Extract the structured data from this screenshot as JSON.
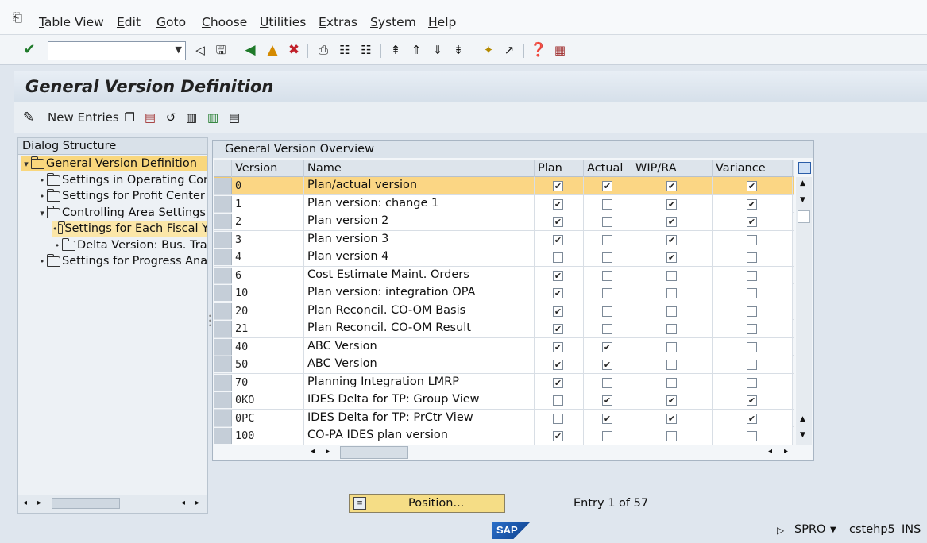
{
  "menu": {
    "items": [
      "Table View",
      "Edit",
      "Goto",
      "Choose",
      "Utilities",
      "Extras",
      "System",
      "Help"
    ]
  },
  "toolbar": {
    "command_field_value": "",
    "icons": [
      "enter-icon",
      "back-arrow-icon",
      "save-icon",
      "back-icon",
      "exit-icon",
      "cancel-icon",
      "print-icon",
      "find-icon",
      "find-next-icon",
      "first-page-icon",
      "prev-page-icon",
      "next-page-icon",
      "last-page-icon",
      "create-session-icon",
      "shortcut-icon",
      "help-icon",
      "customize-layout-icon"
    ]
  },
  "page": {
    "title": "General Version Definition"
  },
  "app_toolbar": {
    "new_entries_label": "New Entries"
  },
  "tree": {
    "header": "Dialog Structure",
    "nodes": [
      {
        "label": "General Version Definition",
        "level": 0,
        "expanded": true,
        "selected": true
      },
      {
        "label": "Settings in Operating Conc",
        "level": 1
      },
      {
        "label": "Settings for Profit Center A",
        "level": 1
      },
      {
        "label": "Controlling Area Settings",
        "level": 1,
        "expanded": true
      },
      {
        "label": "Settings for Each Fiscal Y",
        "level": 2,
        "highlight": true
      },
      {
        "label": "Delta Version: Bus. Tran",
        "level": 2
      },
      {
        "label": "Settings for Progress Analy",
        "level": 1
      }
    ]
  },
  "table": {
    "title": "General Version Overview",
    "columns": [
      "Version",
      "Name",
      "Plan",
      "Actual",
      "WIP/RA",
      "Variance"
    ],
    "rows": [
      {
        "version": "0",
        "name": "Plan/actual version",
        "plan": true,
        "actual": true,
        "wip": true,
        "variance": true,
        "selected": true
      },
      {
        "version": "1",
        "name": "Plan version: change 1",
        "plan": true,
        "actual": false,
        "wip": true,
        "variance": true
      },
      {
        "version": "2",
        "name": "Plan version 2",
        "plan": true,
        "actual": false,
        "wip": true,
        "variance": true
      },
      {
        "version": "3",
        "name": "Plan version 3",
        "plan": true,
        "actual": false,
        "wip": true,
        "variance": false
      },
      {
        "version": "4",
        "name": "Plan version 4",
        "plan": false,
        "actual": false,
        "wip": true,
        "variance": false
      },
      {
        "version": "6",
        "name": "Cost Estimate Maint. Orders",
        "plan": true,
        "actual": false,
        "wip": false,
        "variance": false
      },
      {
        "version": "10",
        "name": "Plan version: integration OPA",
        "plan": true,
        "actual": false,
        "wip": false,
        "variance": false
      },
      {
        "version": "20",
        "name": "Plan Reconcil. CO-OM Basis",
        "plan": true,
        "actual": false,
        "wip": false,
        "variance": false
      },
      {
        "version": "21",
        "name": "Plan Reconcil. CO-OM Result",
        "plan": true,
        "actual": false,
        "wip": false,
        "variance": false
      },
      {
        "version": "40",
        "name": "ABC Version",
        "plan": true,
        "actual": true,
        "wip": false,
        "variance": false
      },
      {
        "version": "50",
        "name": "ABC Version",
        "plan": true,
        "actual": true,
        "wip": false,
        "variance": false
      },
      {
        "version": "70",
        "name": "Planning Integration LMRP",
        "plan": true,
        "actual": false,
        "wip": false,
        "variance": false
      },
      {
        "version": "0KO",
        "name": "IDES Delta for TP: Group View",
        "plan": false,
        "actual": true,
        "wip": true,
        "variance": true
      },
      {
        "version": "0PC",
        "name": "IDES Delta for TP: PrCtr View",
        "plan": false,
        "actual": true,
        "wip": true,
        "variance": true
      },
      {
        "version": "100",
        "name": "CO-PA IDES plan version",
        "plan": true,
        "actual": false,
        "wip": false,
        "variance": false
      }
    ]
  },
  "footer": {
    "position_label": "Position...",
    "entry_info": "Entry 1 of 57"
  },
  "status": {
    "logo_text": "SAP",
    "transaction": "SPRO",
    "server": "cstehp5",
    "mode": "INS"
  }
}
